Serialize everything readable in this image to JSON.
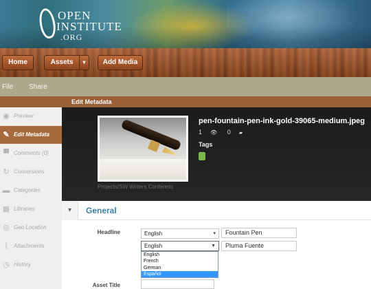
{
  "logo": {
    "line1": "OPEN",
    "line2": "INSTITUTE",
    "line3": ".ORG"
  },
  "toolbar": {
    "home": "Home",
    "assets": "Assets",
    "assets_caret": "▾",
    "add_media": "Add Media"
  },
  "menu": {
    "file": "File",
    "share": "Share"
  },
  "title": "Edit Metadata",
  "sidebar": {
    "items": [
      {
        "label": "Preview",
        "icon": "eye-icon",
        "glyph": "◉"
      },
      {
        "label": "Edit Metadata",
        "icon": "pencil-icon",
        "glyph": "✎"
      },
      {
        "label": "Comments (0)",
        "icon": "comment-icon",
        "glyph": "▀"
      },
      {
        "label": "Conversions",
        "icon": "refresh-icon",
        "glyph": "↻"
      },
      {
        "label": "Categories",
        "icon": "folder-icon",
        "glyph": "▬"
      },
      {
        "label": "Libraries",
        "icon": "book-icon",
        "glyph": "▦"
      },
      {
        "label": "Geo Location",
        "icon": "compass-icon",
        "glyph": "◎"
      },
      {
        "label": "Attachments",
        "icon": "paperclip-icon",
        "glyph": "⌇"
      },
      {
        "label": "History",
        "icon": "history-icon",
        "glyph": "◷"
      }
    ]
  },
  "asset": {
    "filename": "pen-fountain-pen-ink-gold-39065-medium.jpeg",
    "views": "1",
    "views_icon": "👁",
    "comments": "0",
    "comments_icon": "▰",
    "tags_label": "Tags",
    "caption": "Projects/SW Writers Conferenc"
  },
  "section": {
    "toggle": "▾",
    "title": "General"
  },
  "form": {
    "headline_label": "Headline",
    "lang1": "English",
    "headline1": "Fountain Pen",
    "lang2": "English",
    "headline2": "Pluma Fuente",
    "options": [
      "English",
      "French",
      "German",
      "Español"
    ],
    "asset_title_label": "Asset Title"
  }
}
